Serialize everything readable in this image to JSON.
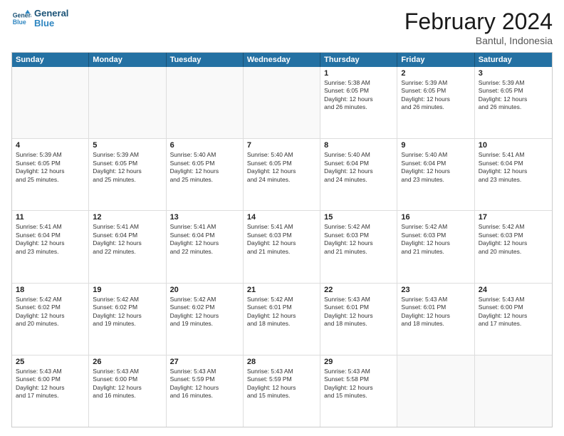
{
  "logo": {
    "line1": "General",
    "line2": "Blue"
  },
  "title": "February 2024",
  "subtitle": "Bantul, Indonesia",
  "header_days": [
    "Sunday",
    "Monday",
    "Tuesday",
    "Wednesday",
    "Thursday",
    "Friday",
    "Saturday"
  ],
  "rows": [
    [
      {
        "day": "",
        "info": ""
      },
      {
        "day": "",
        "info": ""
      },
      {
        "day": "",
        "info": ""
      },
      {
        "day": "",
        "info": ""
      },
      {
        "day": "1",
        "info": "Sunrise: 5:38 AM\nSunset: 6:05 PM\nDaylight: 12 hours\nand 26 minutes."
      },
      {
        "day": "2",
        "info": "Sunrise: 5:39 AM\nSunset: 6:05 PM\nDaylight: 12 hours\nand 26 minutes."
      },
      {
        "day": "3",
        "info": "Sunrise: 5:39 AM\nSunset: 6:05 PM\nDaylight: 12 hours\nand 26 minutes."
      }
    ],
    [
      {
        "day": "4",
        "info": "Sunrise: 5:39 AM\nSunset: 6:05 PM\nDaylight: 12 hours\nand 25 minutes."
      },
      {
        "day": "5",
        "info": "Sunrise: 5:39 AM\nSunset: 6:05 PM\nDaylight: 12 hours\nand 25 minutes."
      },
      {
        "day": "6",
        "info": "Sunrise: 5:40 AM\nSunset: 6:05 PM\nDaylight: 12 hours\nand 25 minutes."
      },
      {
        "day": "7",
        "info": "Sunrise: 5:40 AM\nSunset: 6:05 PM\nDaylight: 12 hours\nand 24 minutes."
      },
      {
        "day": "8",
        "info": "Sunrise: 5:40 AM\nSunset: 6:04 PM\nDaylight: 12 hours\nand 24 minutes."
      },
      {
        "day": "9",
        "info": "Sunrise: 5:40 AM\nSunset: 6:04 PM\nDaylight: 12 hours\nand 23 minutes."
      },
      {
        "day": "10",
        "info": "Sunrise: 5:41 AM\nSunset: 6:04 PM\nDaylight: 12 hours\nand 23 minutes."
      }
    ],
    [
      {
        "day": "11",
        "info": "Sunrise: 5:41 AM\nSunset: 6:04 PM\nDaylight: 12 hours\nand 23 minutes."
      },
      {
        "day": "12",
        "info": "Sunrise: 5:41 AM\nSunset: 6:04 PM\nDaylight: 12 hours\nand 22 minutes."
      },
      {
        "day": "13",
        "info": "Sunrise: 5:41 AM\nSunset: 6:04 PM\nDaylight: 12 hours\nand 22 minutes."
      },
      {
        "day": "14",
        "info": "Sunrise: 5:41 AM\nSunset: 6:03 PM\nDaylight: 12 hours\nand 21 minutes."
      },
      {
        "day": "15",
        "info": "Sunrise: 5:42 AM\nSunset: 6:03 PM\nDaylight: 12 hours\nand 21 minutes."
      },
      {
        "day": "16",
        "info": "Sunrise: 5:42 AM\nSunset: 6:03 PM\nDaylight: 12 hours\nand 21 minutes."
      },
      {
        "day": "17",
        "info": "Sunrise: 5:42 AM\nSunset: 6:03 PM\nDaylight: 12 hours\nand 20 minutes."
      }
    ],
    [
      {
        "day": "18",
        "info": "Sunrise: 5:42 AM\nSunset: 6:02 PM\nDaylight: 12 hours\nand 20 minutes."
      },
      {
        "day": "19",
        "info": "Sunrise: 5:42 AM\nSunset: 6:02 PM\nDaylight: 12 hours\nand 19 minutes."
      },
      {
        "day": "20",
        "info": "Sunrise: 5:42 AM\nSunset: 6:02 PM\nDaylight: 12 hours\nand 19 minutes."
      },
      {
        "day": "21",
        "info": "Sunrise: 5:42 AM\nSunset: 6:01 PM\nDaylight: 12 hours\nand 18 minutes."
      },
      {
        "day": "22",
        "info": "Sunrise: 5:43 AM\nSunset: 6:01 PM\nDaylight: 12 hours\nand 18 minutes."
      },
      {
        "day": "23",
        "info": "Sunrise: 5:43 AM\nSunset: 6:01 PM\nDaylight: 12 hours\nand 18 minutes."
      },
      {
        "day": "24",
        "info": "Sunrise: 5:43 AM\nSunset: 6:00 PM\nDaylight: 12 hours\nand 17 minutes."
      }
    ],
    [
      {
        "day": "25",
        "info": "Sunrise: 5:43 AM\nSunset: 6:00 PM\nDaylight: 12 hours\nand 17 minutes."
      },
      {
        "day": "26",
        "info": "Sunrise: 5:43 AM\nSunset: 6:00 PM\nDaylight: 12 hours\nand 16 minutes."
      },
      {
        "day": "27",
        "info": "Sunrise: 5:43 AM\nSunset: 5:59 PM\nDaylight: 12 hours\nand 16 minutes."
      },
      {
        "day": "28",
        "info": "Sunrise: 5:43 AM\nSunset: 5:59 PM\nDaylight: 12 hours\nand 15 minutes."
      },
      {
        "day": "29",
        "info": "Sunrise: 5:43 AM\nSunset: 5:58 PM\nDaylight: 12 hours\nand 15 minutes."
      },
      {
        "day": "",
        "info": ""
      },
      {
        "day": "",
        "info": ""
      }
    ]
  ]
}
